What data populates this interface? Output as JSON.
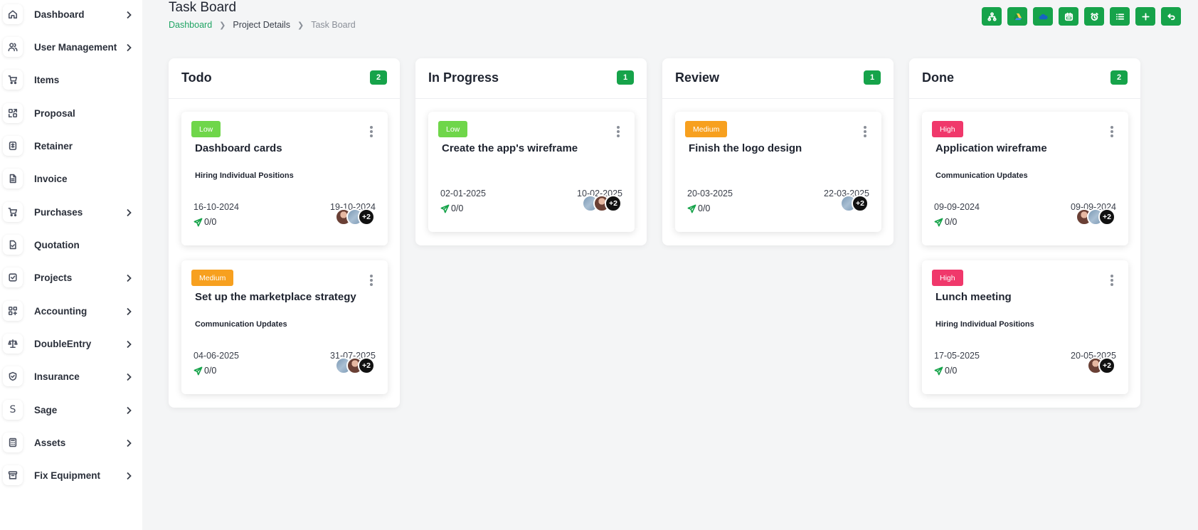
{
  "header": {
    "title": "Task Board",
    "breadcrumb": [
      "Dashboard",
      "Project Details",
      "Task Board"
    ]
  },
  "toolbar": {
    "buttons": [
      "org-chart-icon",
      "drive-icon",
      "onedrive-icon",
      "calendar-icon",
      "timer-icon",
      "list-icon",
      "plus-icon",
      "back-icon"
    ]
  },
  "sidebar": {
    "items": [
      {
        "label": "Dashboard",
        "icon": "home-icon",
        "has_children": true
      },
      {
        "label": "User Management",
        "icon": "users-icon",
        "has_children": true
      },
      {
        "label": "Items",
        "icon": "cart-icon",
        "has_children": false
      },
      {
        "label": "Proposal",
        "icon": "proposal-icon",
        "has_children": false
      },
      {
        "label": "Retainer",
        "icon": "retainer-icon",
        "has_children": false
      },
      {
        "label": "Invoice",
        "icon": "invoice-icon",
        "has_children": false
      },
      {
        "label": "Purchases",
        "icon": "purchase-cart-icon",
        "has_children": true
      },
      {
        "label": "Quotation",
        "icon": "quotation-icon",
        "has_children": false
      },
      {
        "label": "Projects",
        "icon": "projects-icon",
        "has_children": true
      },
      {
        "label": "Accounting",
        "icon": "accounting-icon",
        "has_children": true
      },
      {
        "label": "DoubleEntry",
        "icon": "scale-icon",
        "has_children": true
      },
      {
        "label": "Insurance",
        "icon": "shield-icon",
        "has_children": true
      },
      {
        "label": "Sage",
        "icon": "sage-icon",
        "has_children": true
      },
      {
        "label": "Assets",
        "icon": "calculator-icon",
        "has_children": true
      },
      {
        "label": "Fix Equipment",
        "icon": "archive-icon",
        "has_children": true
      }
    ]
  },
  "columns": [
    {
      "title": "Todo",
      "count": "2",
      "cards": [
        {
          "priority": "Low",
          "title": "Dashboard cards",
          "subtitle": "Hiring Individual Positions",
          "start": "16-10-2024",
          "end": "19-10-2024",
          "progress": "0/0",
          "avatars": [
            "photo",
            "grey"
          ],
          "more": "+2"
        },
        {
          "priority": "Medium",
          "title": "Set up the marketplace strategy",
          "subtitle": "Communication Updates",
          "start": "04-06-2025",
          "end": "31-07-2025",
          "progress": "0/0",
          "avatars": [
            "grey",
            "photo"
          ],
          "more": "+2"
        }
      ]
    },
    {
      "title": "In Progress",
      "count": "1",
      "cards": [
        {
          "priority": "Low",
          "title": "Create the app's wireframe",
          "subtitle": "",
          "start": "02-01-2025",
          "end": "10-02-2025",
          "progress": "0/0",
          "avatars": [
            "grey",
            "photo"
          ],
          "more": "+2"
        }
      ]
    },
    {
      "title": "Review",
      "count": "1",
      "cards": [
        {
          "priority": "Medium",
          "title": "Finish the logo design",
          "subtitle": "",
          "start": "20-03-2025",
          "end": "22-03-2025",
          "progress": "0/0",
          "avatars": [
            "grey"
          ],
          "more": "+2"
        }
      ]
    },
    {
      "title": "Done",
      "count": "2",
      "cards": [
        {
          "priority": "High",
          "title": "Application wireframe",
          "subtitle": "Communication Updates",
          "start": "09-09-2024",
          "end": "09-09-2024",
          "progress": "0/0",
          "avatars": [
            "photo",
            "grey"
          ],
          "more": "+2"
        },
        {
          "priority": "High",
          "title": "Lunch meeting",
          "subtitle": "Hiring Individual Positions",
          "start": "17-05-2025",
          "end": "20-05-2025",
          "progress": "0/0",
          "avatars": [
            "photo"
          ],
          "more": "+2"
        }
      ]
    }
  ],
  "colors": {
    "accent": "#16a34a",
    "breadcrumb_link": "#1fa463",
    "priority_low": "#6fd64a",
    "priority_medium": "#f7a01f",
    "priority_high": "#f0386b"
  }
}
